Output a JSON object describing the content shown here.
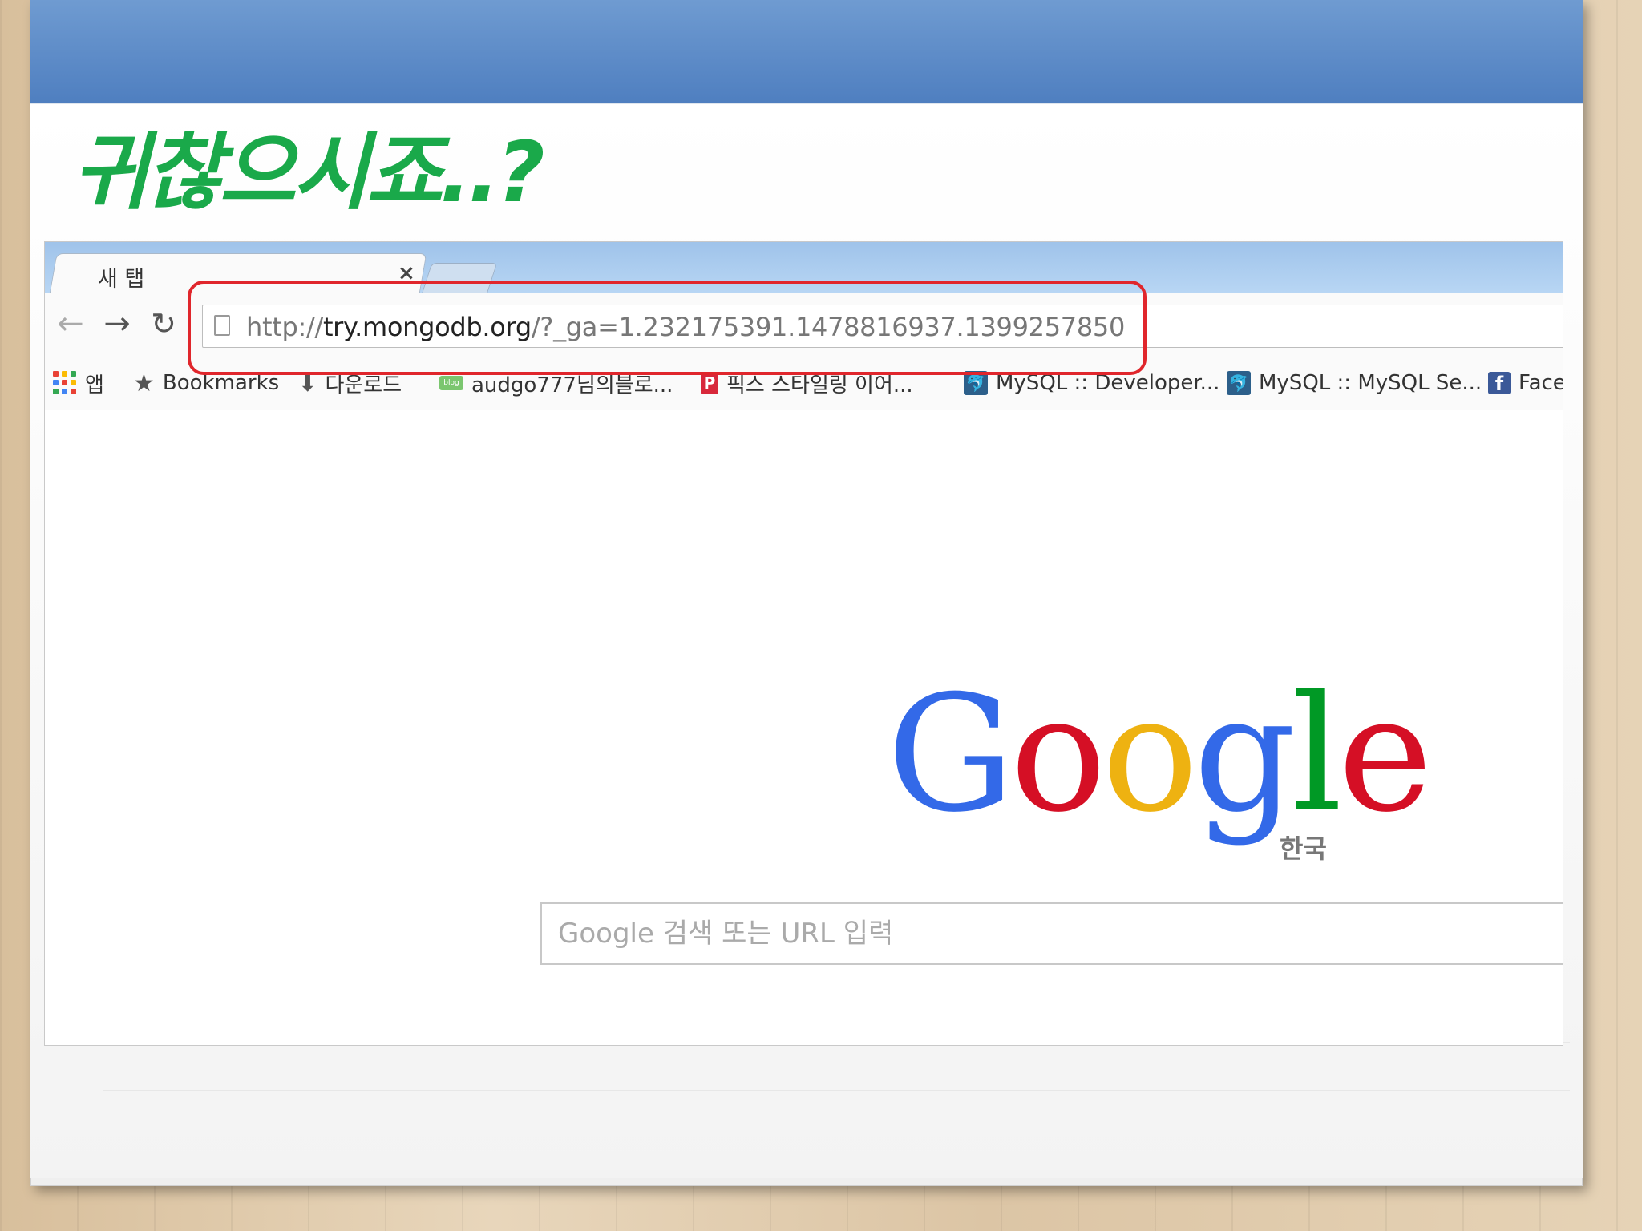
{
  "annotation": {
    "handwritten_text": "귀찮으시죠..?"
  },
  "browser": {
    "tab": {
      "title": "새 탭",
      "close_glyph": "×"
    },
    "nav": {
      "back_glyph": "←",
      "forward_glyph": "→",
      "reload_glyph": "↻"
    },
    "omnibox": {
      "url_scheme": "http://",
      "url_host": "try.mongodb.org",
      "url_rest": "/?_ga=1.232175391.1478816937.1399257850"
    },
    "bookmarks": [
      {
        "label": "앱",
        "icon": "apps-grid-icon"
      },
      {
        "label": "Bookmarks",
        "icon": "star-icon"
      },
      {
        "label": "다운로드",
        "icon": "download-icon"
      },
      {
        "label": "audgo777님의블로...",
        "icon": "blog-icon"
      },
      {
        "label": "픽스 스타일링 이어...",
        "icon": "pix-icon"
      },
      {
        "label": "MySQL :: Developer...",
        "icon": "mysql-icon"
      },
      {
        "label": "MySQL :: MySQL Se...",
        "icon": "mysql-icon"
      },
      {
        "label": "Face",
        "icon": "facebook-icon"
      }
    ]
  },
  "newtab": {
    "logo_letters": [
      "G",
      "o",
      "o",
      "g",
      "l",
      "e"
    ],
    "logo_colors": [
      "#3369e8",
      "#d50f25",
      "#eeb211",
      "#3369e8",
      "#009925",
      "#d50f25"
    ],
    "logo_region": "한국",
    "search_placeholder": "Google 검색 또는 URL 입력"
  },
  "colors": {
    "highlight": "#e0262c",
    "handwriting": "#1aa94a",
    "banner": "#5a88c6"
  }
}
